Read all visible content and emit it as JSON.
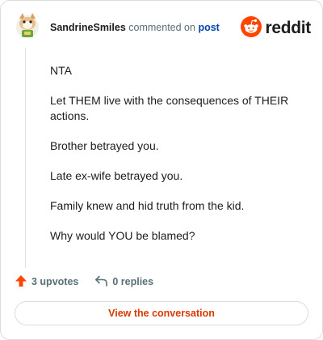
{
  "comment": {
    "username": "SandrineSmiles",
    "action_text": " commented on ",
    "post_link": "post",
    "paragraphs": [
      "NTA",
      "Let THEM live with the consequences of THEIR actions.",
      "Brother betrayed you.",
      "Late ex-wife betrayed you.",
      "Family knew and hid truth from the kid.",
      "Why would YOU be blamed?"
    ]
  },
  "brand": {
    "name": "reddit",
    "color": "#ff4500"
  },
  "footer": {
    "upvotes_label": "3 upvotes",
    "replies_label": "0 replies",
    "cta_label": "View the conversation"
  },
  "icons": {
    "avatar": "cat-avatar-icon",
    "brand": "reddit-snoo-icon",
    "upvote": "upvote-arrow-icon",
    "reply": "reply-arrow-icon"
  },
  "colors": {
    "upvote": "#ff4500",
    "cta_text": "#d93a00",
    "link": "#0045ac"
  }
}
